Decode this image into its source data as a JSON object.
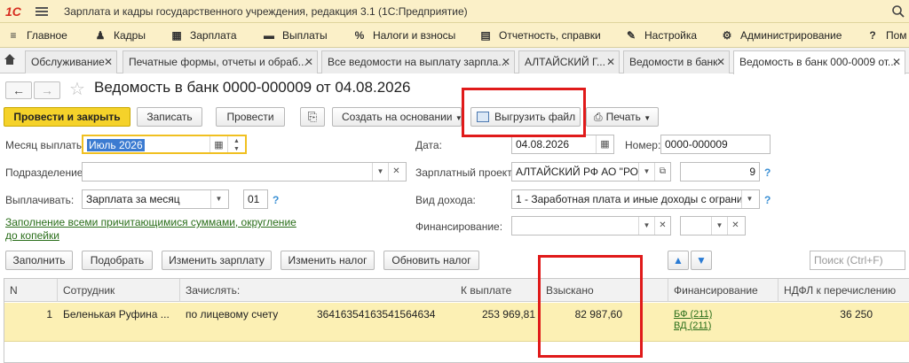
{
  "app": {
    "title": "Зарплата и кадры государственного учреждения, редакция 3.1  (1С:Предприятие)"
  },
  "menu": [
    {
      "label": "Главное",
      "icon": "menu-lines-icon"
    },
    {
      "label": "Кадры",
      "icon": "people-icon"
    },
    {
      "label": "Зарплата",
      "icon": "calculator-icon"
    },
    {
      "label": "Выплаты",
      "icon": "wallet-icon"
    },
    {
      "label": "Налоги и взносы",
      "icon": "percent-icon"
    },
    {
      "label": "Отчетность, справки",
      "icon": "report-icon"
    },
    {
      "label": "Настройка",
      "icon": "wrench-icon"
    },
    {
      "label": "Администрирование",
      "icon": "gear-icon"
    },
    {
      "label": "Пом",
      "icon": "question-icon"
    }
  ],
  "tabs": [
    {
      "label": "Обслуживание"
    },
    {
      "label": "Печатные формы, отчеты и обраб..."
    },
    {
      "label": "Все ведомости на выплату зарпла..."
    },
    {
      "label": "АЛТАЙСКИЙ Г..."
    },
    {
      "label": "Ведомости в банк"
    },
    {
      "label": "Ведомость в банк 000-0009 от..."
    }
  ],
  "document": {
    "title": "Ведомость в банк 0000-000009 от 04.08.2026"
  },
  "toolbar": {
    "post_close": "Провести и закрыть",
    "save": "Записать",
    "post": "Провести",
    "create_based": "Создать на основании",
    "export_file": "Выгрузить файл",
    "print": "Печать"
  },
  "form": {
    "month_label": "Месяц выплаты:",
    "month_value": "Июль 2026",
    "date_label": "Дата:",
    "date_value": "04.08.2026",
    "number_label": "Номер:",
    "number_value": "0000-000009",
    "division_label": "Подразделение:",
    "division_value": "",
    "project_label": "Зарплатный проект:",
    "project_value": "АЛТАЙСКИЙ РФ АО \"РО",
    "project_number": "9",
    "pay_label": "Выплачивать:",
    "pay_value": "Зарплата за месяц",
    "pay_code": "01",
    "income_label": "Вид дохода:",
    "income_value": "1 - Заработная плата и иные доходы с огранич",
    "fill_link": "Заполнение всеми причитающимися суммами, округление до копейки",
    "financing_label": "Финансирование:",
    "question_mark": "?"
  },
  "table_toolbar": {
    "fill": "Заполнить",
    "select": "Подобрать",
    "change_salary": "Изменить зарплату",
    "change_tax": "Изменить налог",
    "update_tax": "Обновить налог",
    "search_placeholder": "Поиск (Ctrl+F)"
  },
  "table": {
    "columns": [
      "N",
      "Сотрудник",
      "Зачислять:",
      "К выплате",
      "Взыскано",
      "Финансирование",
      "НДФЛ к перечислению"
    ],
    "rows": [
      {
        "n": "1",
        "employee": "Беленькая Руфина ...",
        "credit_to": "по лицевому счету",
        "account": "36416354163541564634",
        "to_pay": "253 969,81",
        "withheld": "82 987,60",
        "fin_1": "БФ (211)",
        "fin_2": "ВД (211)",
        "ndfl": "36 250"
      }
    ]
  },
  "colors": {
    "accent": "#f5d22a",
    "header_bg": "#fbf0c8",
    "highlight": "#e01a1a",
    "selected_row": "#fcf0b4"
  }
}
